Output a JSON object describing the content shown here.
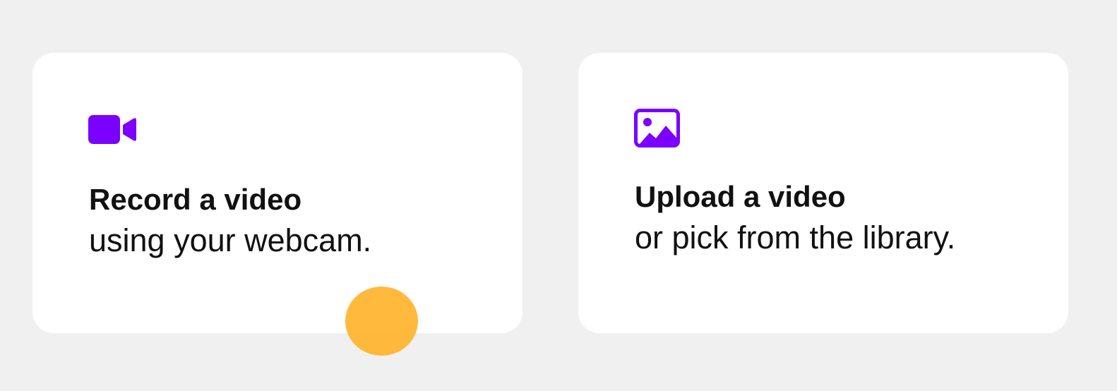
{
  "colors": {
    "accent": "#7b00ff",
    "background": "#f0f0f0",
    "card": "#ffffff",
    "text": "#111111",
    "pointer": "#ffb228"
  },
  "options": [
    {
      "icon": "video-camera-icon",
      "title": "Record a video",
      "subtitle": "using your webcam."
    },
    {
      "icon": "image-icon",
      "title": "Upload a video",
      "subtitle": "or pick from the library."
    }
  ]
}
